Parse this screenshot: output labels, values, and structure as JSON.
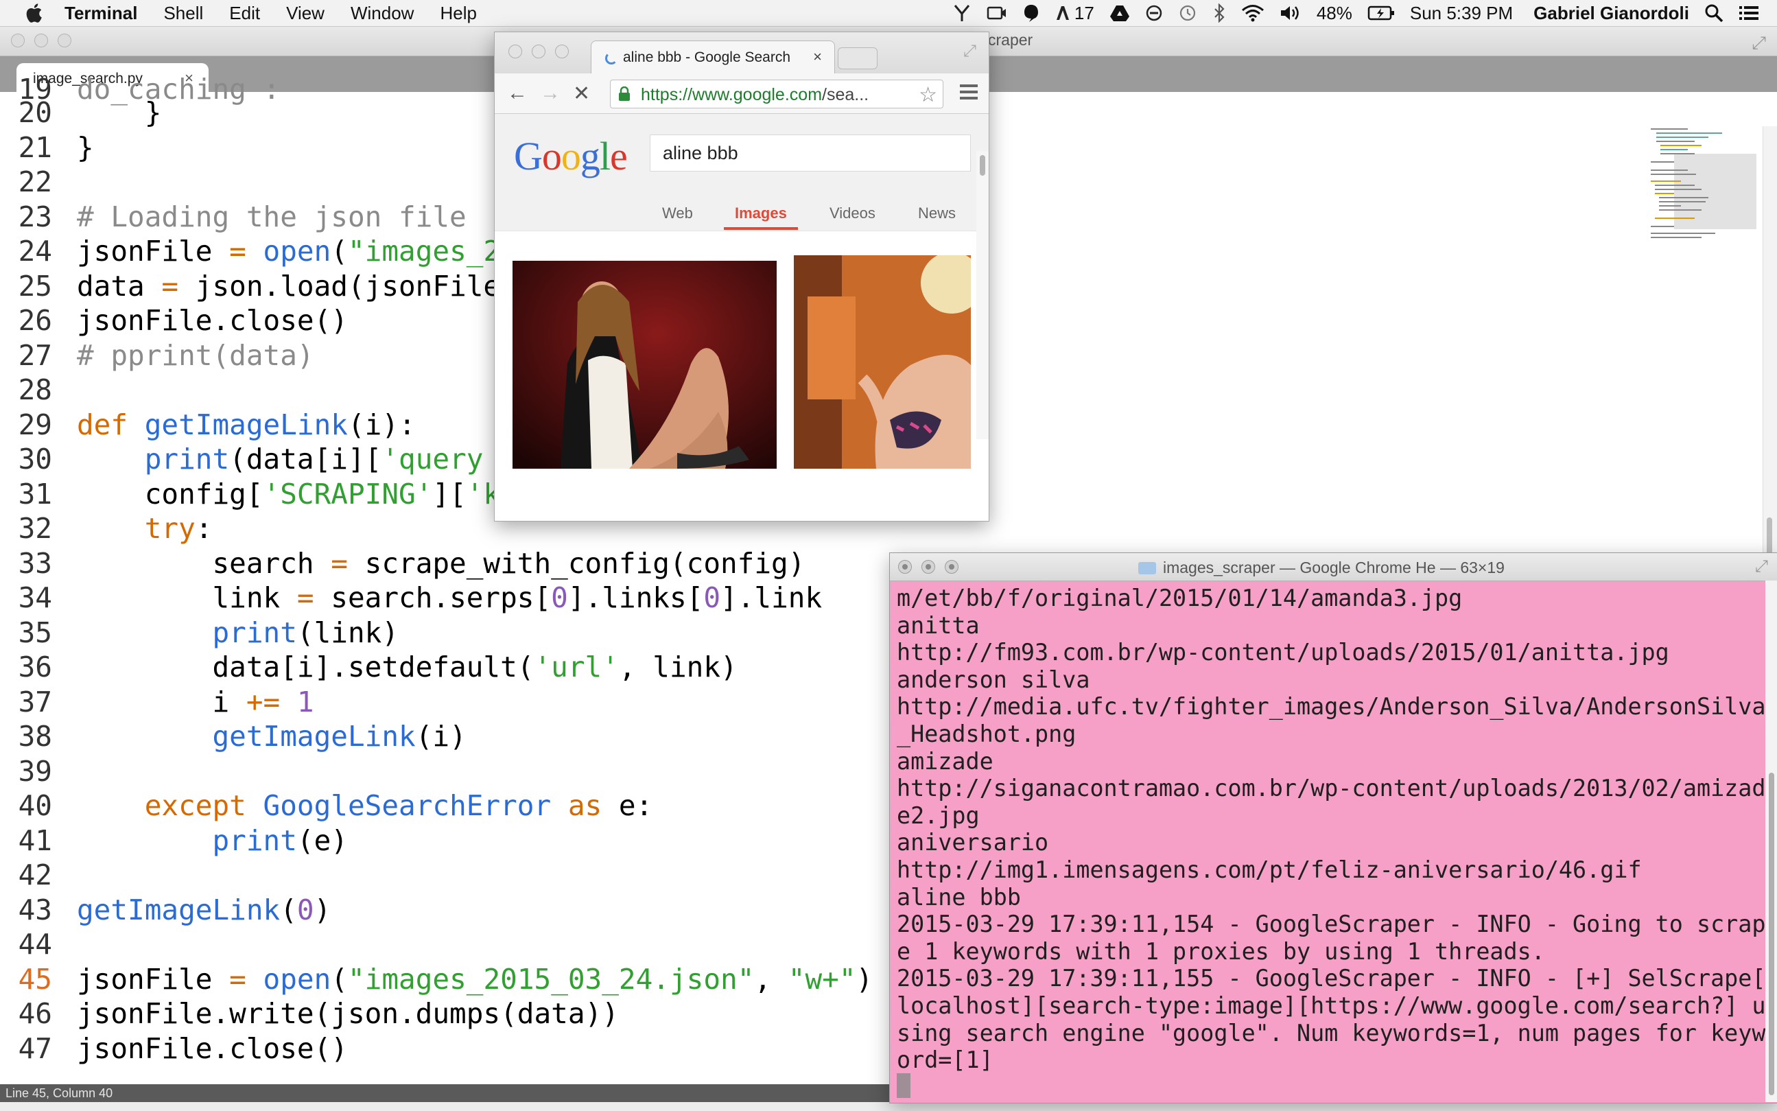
{
  "menubar": {
    "app_name": "Terminal",
    "items": [
      "Shell",
      "Edit",
      "View",
      "Window",
      "Help"
    ],
    "notification_count": "17",
    "battery": "48%",
    "clock": "Sun 5:39 PM",
    "user": "Gabriel Gianordoli"
  },
  "editor": {
    "title_fragment": "craper",
    "tab_label": "image_search.py",
    "tab_close": "×",
    "status": "Line 45, Column 40",
    "active_line": "45"
  },
  "chrome": {
    "tab_title": "aline bbb - Google Search",
    "tab_close": "×",
    "url_scheme_host": "https://www.google.com",
    "url_rest": "/sea...",
    "logo": "Google",
    "search_value": "aline bbb",
    "tabs": [
      "Web",
      "Images",
      "Videos",
      "News"
    ],
    "active_tab": "Images"
  },
  "terminal": {
    "title": "images_scraper — Google Chrome He — 63×19",
    "lines": [
      "m/et/bb/f/original/2015/01/14/amanda3.jpg",
      "anitta",
      "http://fm93.com.br/wp-content/uploads/2015/01/anitta.jpg",
      "anderson silva",
      "http://media.ufc.tv/fighter_images/Anderson_Silva/AndersonSilva",
      "_Headshot.png",
      "amizade",
      "http://siganacontramao.com.br/wp-content/uploads/2013/02/amizad",
      "e2.jpg",
      "aniversario",
      "http://img1.imensagens.com/pt/feliz-aniversario/46.gif",
      "aline bbb",
      "2015-03-29 17:39:11,154 - GoogleScraper - INFO - Going to scrap",
      "e 1 keywords with 1 proxies by using 1 threads.",
      "2015-03-29 17:39:11,155 - GoogleScraper - INFO - [+] SelScrape[",
      "localhost][search-type:image][https://www.google.com/search?] u",
      "sing search engine \"google\". Num keywords=1, num pages for keyw",
      "ord=[1]"
    ]
  },
  "code": {
    "partial_line": "do_caching : ",
    "lines": [
      {
        "n": "20",
        "t": "    }"
      },
      {
        "n": "21",
        "t": "}"
      },
      {
        "n": "22",
        "t": ""
      },
      {
        "n": "23",
        "t": "# Loading the json file"
      },
      {
        "n": "24",
        "t": "jsonFile = open(\"images_2"
      },
      {
        "n": "25",
        "t": "data = json.load(jsonFile"
      },
      {
        "n": "26",
        "t": "jsonFile.close()"
      },
      {
        "n": "27",
        "t": "# pprint(data)"
      },
      {
        "n": "28",
        "t": ""
      },
      {
        "n": "29",
        "t": "def getImageLink(i):"
      },
      {
        "n": "30",
        "t": "    print(data[i]['query"
      },
      {
        "n": "31",
        "t": "    config['SCRAPING']['k"
      },
      {
        "n": "32",
        "t": "    try:"
      },
      {
        "n": "33",
        "t": "        search = scrape_with_config(config)"
      },
      {
        "n": "34",
        "t": "        link = search.serps[0].links[0].link"
      },
      {
        "n": "35",
        "t": "        print(link)"
      },
      {
        "n": "36",
        "t": "        data[i].setdefault('url', link)"
      },
      {
        "n": "37",
        "t": "        i += 1"
      },
      {
        "n": "38",
        "t": "        getImageLink(i)"
      },
      {
        "n": "39",
        "t": ""
      },
      {
        "n": "40",
        "t": "    except GoogleSearchError as e:"
      },
      {
        "n": "41",
        "t": "        print(e)"
      },
      {
        "n": "42",
        "t": ""
      },
      {
        "n": "43",
        "t": "getImageLink(0)"
      },
      {
        "n": "44",
        "t": ""
      },
      {
        "n": "45",
        "t": "jsonFile = open(\"images_2015_03_24.json\", \"w+\")"
      },
      {
        "n": "46",
        "t": "jsonFile.write(json.dumps(data))"
      },
      {
        "n": "47",
        "t": "jsonFile.close()"
      }
    ]
  },
  "colors": {
    "terminal_bg": "#f6a0c7",
    "keyword": "#d66a00",
    "function": "#2a6bd6",
    "string": "#30a030",
    "comment": "#8a8a8a",
    "number": "#8a58b8",
    "google_active_tab": "#dd4b39"
  },
  "icons": [
    "apple-icon",
    "wifi-icon",
    "bluetooth-icon",
    "volume-icon",
    "battery-icon",
    "search-icon",
    "list-icon",
    "lock-icon",
    "star-icon",
    "back-icon",
    "forward-icon",
    "stop-icon",
    "menu-icon",
    "folder-icon"
  ]
}
